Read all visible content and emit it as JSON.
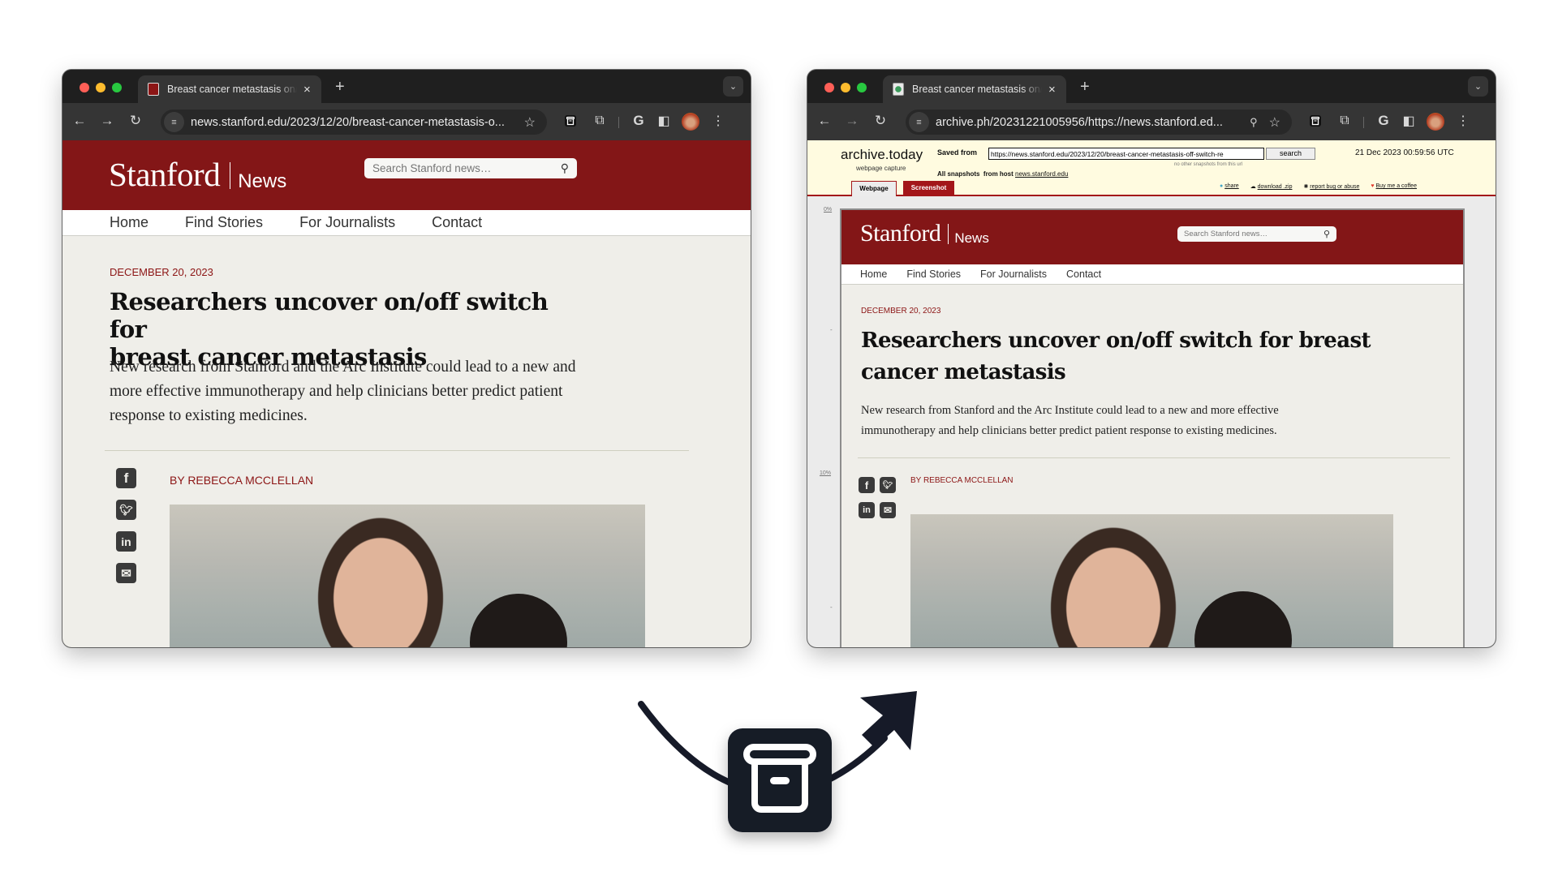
{
  "left_window": {
    "tab": {
      "title": "Breast cancer metastasis on/off switch",
      "favicon": "stanford-tree-favicon",
      "close": "×"
    },
    "new_tab": "+",
    "tab_menu": "⌄",
    "toolbar": {
      "back": "←",
      "forward": "→",
      "reload": "↻",
      "url": "news.stanford.edu/2023/12/20/breast-cancer-metastasis-o...",
      "bookmark": "☆"
    },
    "page": {
      "logo_word": "Stanford",
      "logo_section": "News",
      "search_placeholder": "Search Stanford news…",
      "nav": [
        "Home",
        "Find Stories",
        "For Journalists",
        "Contact"
      ],
      "date": "DECEMBER 20, 2023",
      "headline_line1": "Researchers uncover on/off switch for",
      "headline_line2": "breast cancer metastasis",
      "dek": "New research from Stanford and the Arc Institute could lead to a new and more effective immunotherapy and help clinicians better predict patient response to existing medicines.",
      "byline": "BY REBECCA MCCLELLAN",
      "share": [
        "f",
        "t",
        "in",
        "✉"
      ]
    }
  },
  "right_window": {
    "tab": {
      "title": "Breast cancer metastasis on/off switch",
      "favicon": "archive-favicon",
      "close": "×"
    },
    "new_tab": "+",
    "tab_menu": "⌄",
    "toolbar": {
      "back": "←",
      "forward": "→",
      "reload": "↻",
      "url": "archive.ph/20231221005956/https://news.stanford.ed...",
      "zoom": "🔍︎",
      "bookmark": "☆"
    },
    "archive": {
      "brand": "archive.today",
      "brand_sub": "webpage capture",
      "saved_from_label": "Saved from",
      "saved_from_value": "https://news.stanford.edu/2023/12/20/breast-cancer-metastasis-off-switch-re",
      "search_button": "search",
      "no_other": "no other snapshots from this url",
      "timestamp": "21 Dec 2023 00:59:56 UTC",
      "all_snapshots": "All snapshots",
      "from_host": "from host",
      "host_link": "news.stanford.edu",
      "tabs": [
        "Webpage",
        "Screenshot"
      ],
      "links": [
        "share",
        "download .zip",
        "report bug or abuse",
        "Buy me a coffee"
      ],
      "gutter": [
        "0%",
        "10%"
      ]
    },
    "page": {
      "logo_word": "Stanford",
      "logo_section": "News",
      "search_placeholder": "Search Stanford news…",
      "nav": [
        "Home",
        "Find Stories",
        "For Journalists",
        "Contact"
      ],
      "date": "DECEMBER 20, 2023",
      "headline_line1": "Researchers uncover on/off switch for breast",
      "headline_line2": "cancer metastasis",
      "dek_line1": "New research from Stanford and the Arc Institute could lead to a new and more effective",
      "dek_line2": "immunotherapy and help clinicians better predict patient response to existing medicines.",
      "byline": "BY REBECCA MCCLELLAN",
      "share": [
        "f",
        "t",
        "in",
        "✉"
      ]
    }
  },
  "colors": {
    "stanford_red": "#831617",
    "cardinal_text": "#8c1515",
    "archive_bg": "#fffbe0",
    "archive_red": "#a3161a",
    "icon_dark": "#161a28"
  }
}
